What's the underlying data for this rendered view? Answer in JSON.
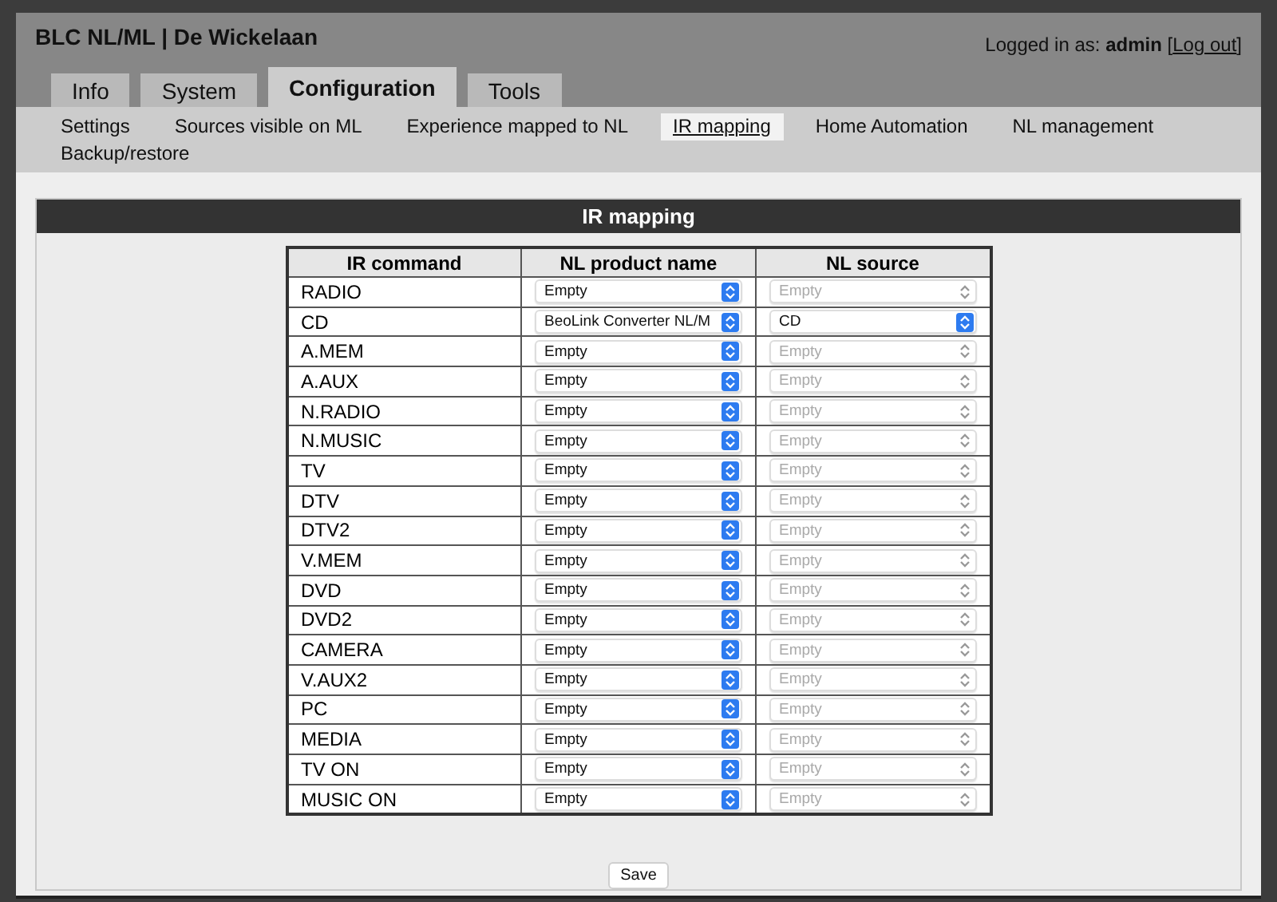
{
  "header": {
    "title": "BLC NL/ML | De Wickelaan",
    "login_label": "Logged in as:",
    "user": "admin",
    "logout": "Log out",
    "logout_open": "[",
    "logout_close": "]"
  },
  "tabs": [
    {
      "label": "Info",
      "selected": false
    },
    {
      "label": "System",
      "selected": false
    },
    {
      "label": "Configuration",
      "selected": true
    },
    {
      "label": "Tools",
      "selected": false
    }
  ],
  "subnav": [
    {
      "label": "Settings",
      "selected": false
    },
    {
      "label": "Sources visible on ML",
      "selected": false
    },
    {
      "label": "Experience mapped to NL",
      "selected": false
    },
    {
      "label": "IR mapping",
      "selected": true
    },
    {
      "label": "Home Automation",
      "selected": false
    },
    {
      "label": "NL management",
      "selected": false
    },
    {
      "label": "Backup/restore",
      "selected": false
    }
  ],
  "panel": {
    "title": "IR mapping"
  },
  "table": {
    "columns": [
      "IR command",
      "NL product name",
      "NL source"
    ],
    "rows": [
      {
        "command": "RADIO",
        "product": "Empty",
        "source": "Empty",
        "source_disabled": true
      },
      {
        "command": "CD",
        "product": "BeoLink Converter NL/M",
        "source": "CD",
        "source_disabled": false
      },
      {
        "command": "A.MEM",
        "product": "Empty",
        "source": "Empty",
        "source_disabled": true
      },
      {
        "command": "A.AUX",
        "product": "Empty",
        "source": "Empty",
        "source_disabled": true
      },
      {
        "command": "N.RADIO",
        "product": "Empty",
        "source": "Empty",
        "source_disabled": true
      },
      {
        "command": "N.MUSIC",
        "product": "Empty",
        "source": "Empty",
        "source_disabled": true
      },
      {
        "command": "TV",
        "product": "Empty",
        "source": "Empty",
        "source_disabled": true
      },
      {
        "command": "DTV",
        "product": "Empty",
        "source": "Empty",
        "source_disabled": true
      },
      {
        "command": "DTV2",
        "product": "Empty",
        "source": "Empty",
        "source_disabled": true
      },
      {
        "command": "V.MEM",
        "product": "Empty",
        "source": "Empty",
        "source_disabled": true
      },
      {
        "command": "DVD",
        "product": "Empty",
        "source": "Empty",
        "source_disabled": true
      },
      {
        "command": "DVD2",
        "product": "Empty",
        "source": "Empty",
        "source_disabled": true
      },
      {
        "command": "CAMERA",
        "product": "Empty",
        "source": "Empty",
        "source_disabled": true
      },
      {
        "command": "V.AUX2",
        "product": "Empty",
        "source": "Empty",
        "source_disabled": true
      },
      {
        "command": "PC",
        "product": "Empty",
        "source": "Empty",
        "source_disabled": true
      },
      {
        "command": "MEDIA",
        "product": "Empty",
        "source": "Empty",
        "source_disabled": true
      },
      {
        "command": "TV ON",
        "product": "Empty",
        "source": "Empty",
        "source_disabled": true
      },
      {
        "command": "MUSIC ON",
        "product": "Empty",
        "source": "Empty",
        "source_disabled": true
      }
    ]
  },
  "save_button": "Save"
}
